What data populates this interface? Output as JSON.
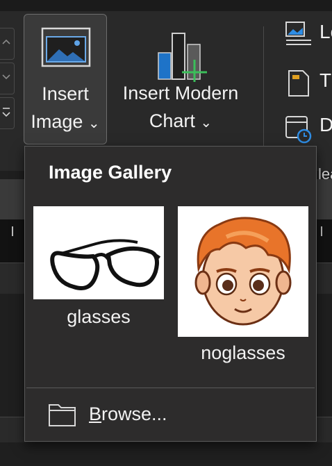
{
  "ribbon": {
    "insert_image": {
      "line1": "Insert",
      "line2": "Image",
      "caret": "⌄"
    },
    "insert_chart": {
      "line1": "Insert Modern",
      "line2": "Chart",
      "caret": "⌄"
    },
    "side_items": [
      {
        "icon": "picture-icon",
        "label": "Lo"
      },
      {
        "icon": "document-icon",
        "label": "T"
      },
      {
        "icon": "calendar-clock-icon",
        "label": "D"
      }
    ],
    "side_bottom_text": "lea"
  },
  "gallery": {
    "title": "Image Gallery",
    "images": [
      {
        "label": "glasses",
        "icon": "glasses-thumbnail"
      },
      {
        "label": "noglasses",
        "icon": "cartoon-face-thumbnail"
      }
    ],
    "browse": {
      "underline": "B",
      "rest": "rowse..."
    }
  },
  "colors": {
    "ribbon": "#292929",
    "dropdown": "#2d2c2c",
    "chart_blue": "#1e73c8",
    "chart_green": "#3bbf5a",
    "calendar_blue": "#2f8de4"
  }
}
